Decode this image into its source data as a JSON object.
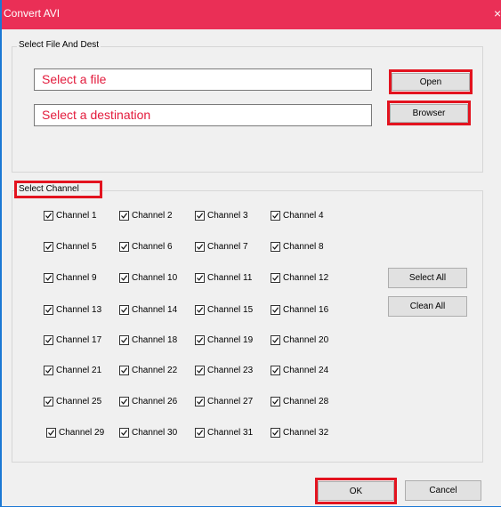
{
  "window": {
    "title": "Convert AVI",
    "close_glyph": "×"
  },
  "file_group": {
    "legend": "Select File And Dest",
    "file_placeholder": "Select a file",
    "dest_placeholder": "Select a destination",
    "open_label": "Open",
    "browser_label": "Browser"
  },
  "channel_group": {
    "legend": "Select Channel",
    "select_all_label": "Select All",
    "clean_all_label": "Clean All",
    "channels": [
      {
        "label": "Channel 1",
        "checked": true
      },
      {
        "label": "Channel 2",
        "checked": true
      },
      {
        "label": "Channel 3",
        "checked": true
      },
      {
        "label": "Channel 4",
        "checked": true
      },
      {
        "label": "Channel 5",
        "checked": true
      },
      {
        "label": "Channel 6",
        "checked": true
      },
      {
        "label": "Channel 7",
        "checked": true
      },
      {
        "label": "Channel 8",
        "checked": true
      },
      {
        "label": "Channel 9",
        "checked": true
      },
      {
        "label": "Channel 10",
        "checked": true
      },
      {
        "label": "Channel 11",
        "checked": true
      },
      {
        "label": "Channel 12",
        "checked": true
      },
      {
        "label": "Channel 13",
        "checked": true
      },
      {
        "label": "Channel 14",
        "checked": true
      },
      {
        "label": "Channel 15",
        "checked": true
      },
      {
        "label": "Channel 16",
        "checked": true
      },
      {
        "label": "Channel 17",
        "checked": true
      },
      {
        "label": "Channel 18",
        "checked": true
      },
      {
        "label": "Channel 19",
        "checked": true
      },
      {
        "label": "Channel 20",
        "checked": true
      },
      {
        "label": "Channel 21",
        "checked": true
      },
      {
        "label": "Channel 22",
        "checked": true
      },
      {
        "label": "Channel 23",
        "checked": true
      },
      {
        "label": "Channel 24",
        "checked": true
      },
      {
        "label": "Channel 25",
        "checked": true
      },
      {
        "label": "Channel 26",
        "checked": true
      },
      {
        "label": "Channel 27",
        "checked": true
      },
      {
        "label": "Channel 28",
        "checked": true
      },
      {
        "label": "Channel 29",
        "checked": true
      },
      {
        "label": "Channel 30",
        "checked": true
      },
      {
        "label": "Channel 31",
        "checked": true
      },
      {
        "label": "Channel 32",
        "checked": true
      }
    ]
  },
  "footer": {
    "ok_label": "OK",
    "cancel_label": "Cancel"
  },
  "colors": {
    "title_bar": "#ea2f56",
    "highlight": "#e3131f",
    "field_text": "#e31b3c",
    "window_border": "#1b78d4"
  }
}
